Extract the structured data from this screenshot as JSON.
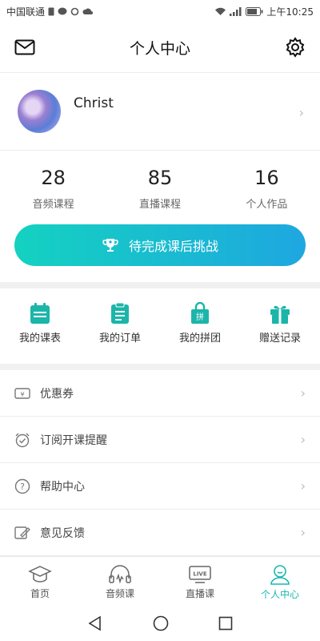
{
  "status_bar": {
    "carrier": "中国联通",
    "time": "上午10:25"
  },
  "header": {
    "title": "个人中心"
  },
  "profile": {
    "name": "Christ"
  },
  "stats": [
    {
      "value": "28",
      "label": "音频课程"
    },
    {
      "value": "85",
      "label": "直播课程"
    },
    {
      "value": "16",
      "label": "个人作品"
    }
  ],
  "challenge": {
    "label": "待完成课后挑战"
  },
  "grid": [
    {
      "label": "我的课表",
      "icon": "schedule-icon"
    },
    {
      "label": "我的订单",
      "icon": "order-icon"
    },
    {
      "label": "我的拼团",
      "icon": "group-buy-icon"
    },
    {
      "label": "赠送记录",
      "icon": "gift-icon"
    }
  ],
  "list": [
    {
      "label": "优惠券",
      "icon": "coupon-icon"
    },
    {
      "label": "订阅开课提醒",
      "icon": "alarm-icon"
    },
    {
      "label": "帮助中心",
      "icon": "help-icon"
    },
    {
      "label": "意见反馈",
      "icon": "feedback-icon"
    }
  ],
  "tabs": [
    {
      "label": "首页",
      "icon": "home-graduation-cap-icon"
    },
    {
      "label": "音频课",
      "icon": "headphones-icon"
    },
    {
      "label": "直播课",
      "icon": "live-tv-icon",
      "badge": "LIVE"
    },
    {
      "label": "个人中心",
      "icon": "person-icon",
      "active": true
    }
  ],
  "colors": {
    "accent": "#18b8b0",
    "gradient_start": "#14d2c0",
    "gradient_end": "#1ea7e0"
  }
}
